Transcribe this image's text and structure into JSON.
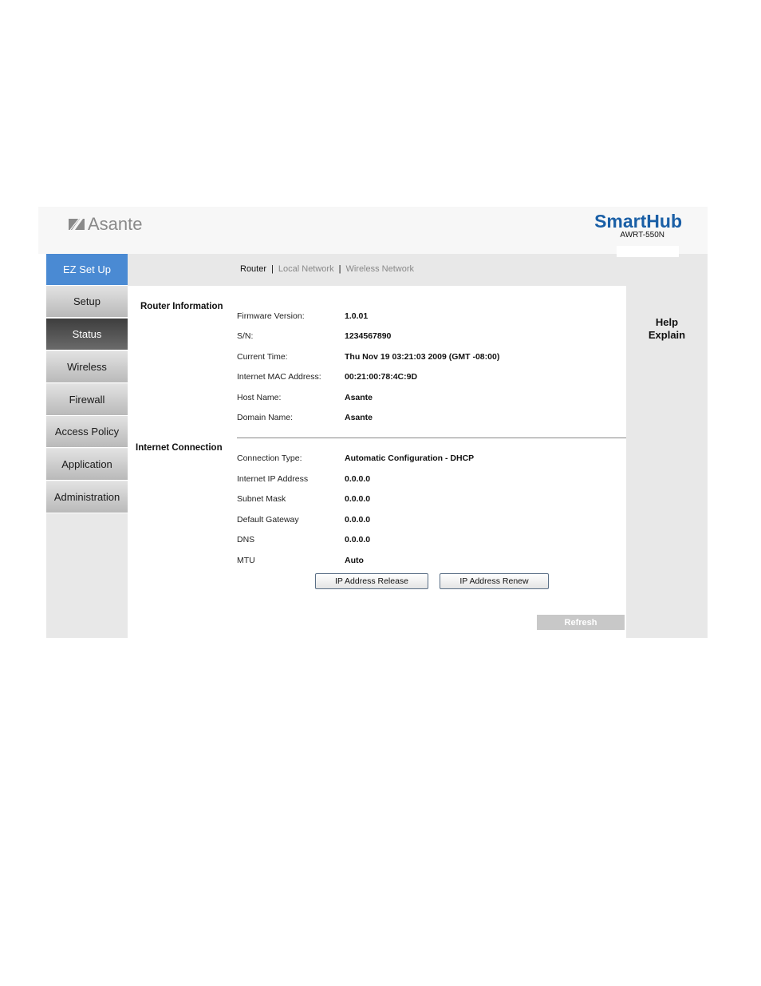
{
  "header": {
    "logo_text": "Asante",
    "brand_name": "SmartHub",
    "brand_model": "AWRT-550N"
  },
  "sidebar": {
    "items": [
      {
        "label": "EZ Set Up"
      },
      {
        "label": "Setup"
      },
      {
        "label": "Status"
      },
      {
        "label": "Wireless"
      },
      {
        "label": "Firewall"
      },
      {
        "label": "Access Policy"
      },
      {
        "label": "Application"
      },
      {
        "label": "Administration"
      }
    ],
    "active": "Status"
  },
  "topnav": {
    "router": "Router",
    "local_network": "Local Network",
    "wireless_network": "Wireless Network",
    "separator": "|"
  },
  "router_info": {
    "title": "Router Information",
    "rows": [
      {
        "label": "Firmware Version:",
        "value": "1.0.01"
      },
      {
        "label": "S/N:",
        "value": "1234567890"
      },
      {
        "label": "Current Time:",
        "value": "Thu Nov 19 03:21:03 2009 (GMT -08:00)"
      },
      {
        "label": "Internet MAC Address:",
        "value": "00:21:00:78:4C:9D"
      },
      {
        "label": "Host Name:",
        "value": "Asante"
      },
      {
        "label": "Domain Name:",
        "value": "Asante"
      }
    ]
  },
  "internet_connection": {
    "title": "Internet Connection",
    "rows": [
      {
        "label": "Connection Type:",
        "value": "Automatic Configuration - DHCP"
      },
      {
        "label": "Internet IP Address",
        "value": "0.0.0.0"
      },
      {
        "label": "Subnet Mask",
        "value": "0.0.0.0"
      },
      {
        "label": "Default Gateway",
        "value": "0.0.0.0"
      },
      {
        "label": "DNS",
        "value": "0.0.0.0"
      },
      {
        "label": "MTU",
        "value": "Auto"
      }
    ]
  },
  "buttons": {
    "release": "IP Address Release",
    "renew": "IP Address Renew",
    "refresh": "Refresh"
  },
  "help": {
    "line1": "Help",
    "line2": "Explain"
  },
  "colors": {
    "accent_blue": "#4a8ad3",
    "brand_blue": "#1a5fa6",
    "active_tab": "#3e3e3e",
    "panel_gray": "#e8e8e8"
  }
}
